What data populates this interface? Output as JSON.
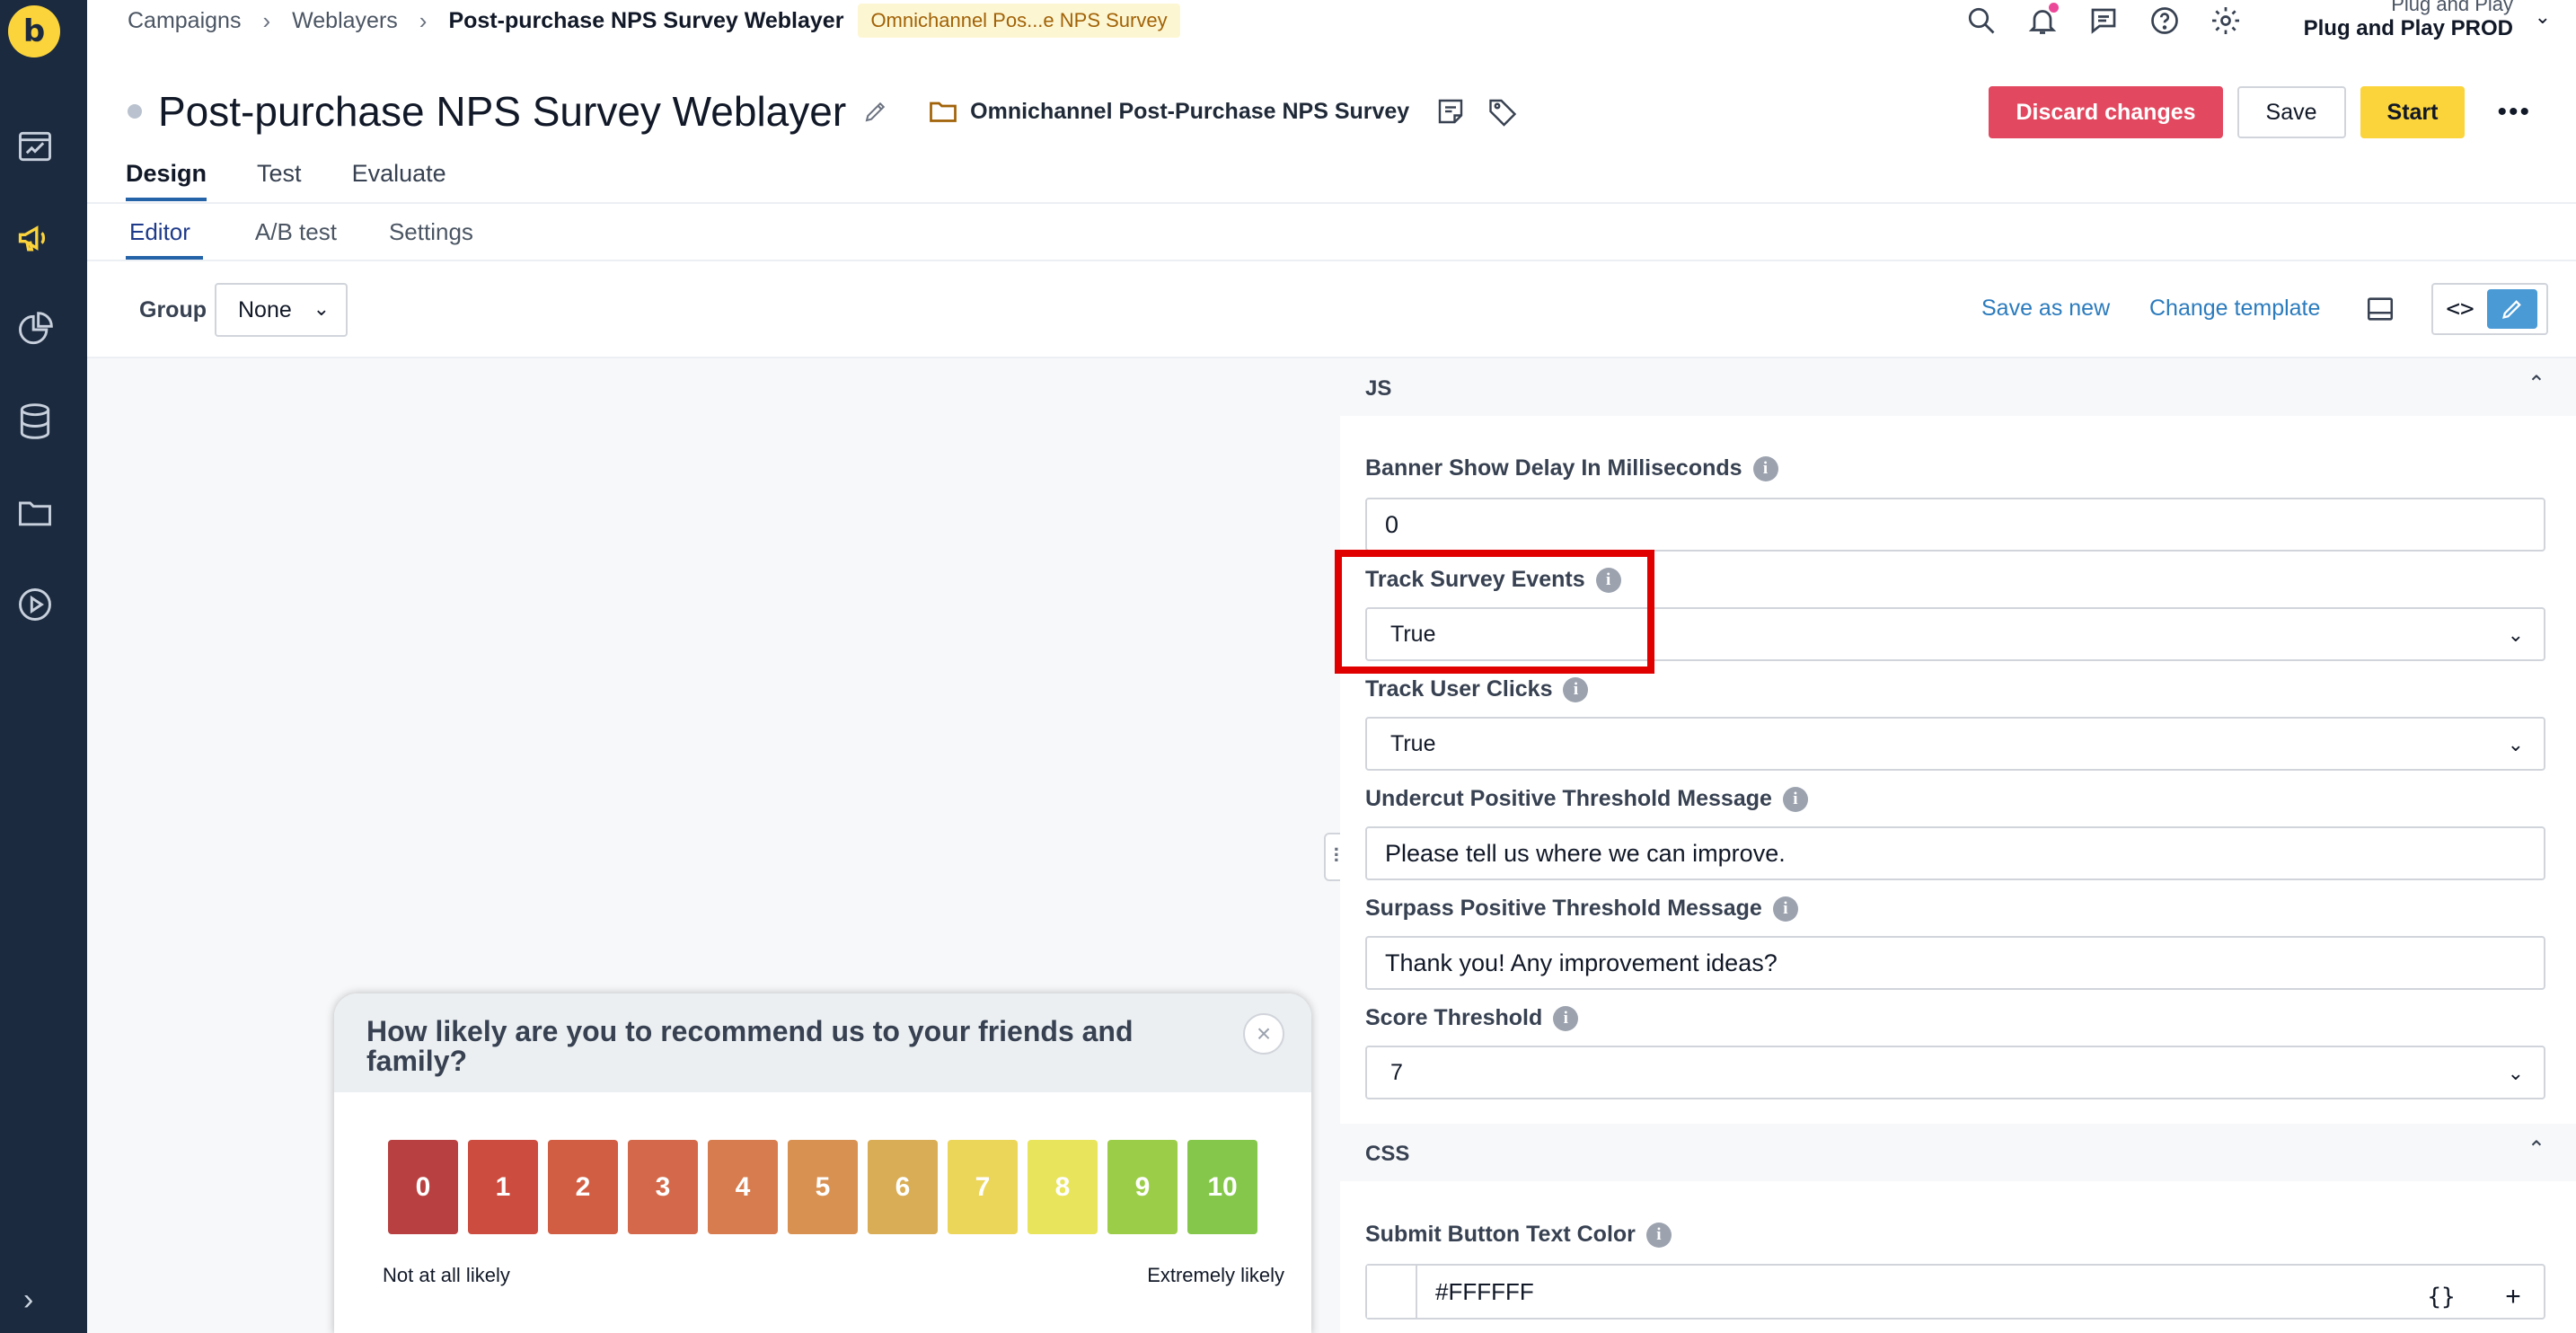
{
  "breadcrumb": {
    "items": [
      "Campaigns",
      "Weblayers",
      "Post-purchase NPS Survey Weblayer"
    ],
    "tag": "Omnichannel Pos...e NPS Survey"
  },
  "account": {
    "org": "Plug and Play",
    "project": "Plug and Play PROD"
  },
  "header": {
    "title": "Post-purchase NPS Survey Weblayer",
    "folder": "Omnichannel Post-Purchase NPS Survey",
    "discard_label": "Discard changes",
    "save_label": "Save",
    "start_label": "Start",
    "more_label": "•••"
  },
  "tabs_main": [
    "Design",
    "Test",
    "Evaluate"
  ],
  "tabs_sub": [
    "Editor",
    "A/B test",
    "Settings"
  ],
  "toolbar": {
    "group_label": "Group",
    "group_value": "None",
    "save_as_new": "Save as new",
    "change_template": "Change template",
    "code_label": "<>"
  },
  "survey": {
    "question": "How likely are you to recommend us to your friends and family?",
    "close_label": "×",
    "scores": [
      "0",
      "1",
      "2",
      "3",
      "4",
      "5",
      "6",
      "7",
      "8",
      "9",
      "10"
    ],
    "score_colors": [
      "#b84040",
      "#cc4c3f",
      "#d15d42",
      "#d3694a",
      "#d77c4e",
      "#d89151",
      "#d8ad55",
      "#ecd65a",
      "#e8e45c",
      "#9ccd48",
      "#84c74a"
    ],
    "low_label": "Not at all likely",
    "high_label": "Extremely likely"
  },
  "panel": {
    "js_section": "JS",
    "css_section": "CSS",
    "fields": {
      "banner_delay": {
        "label": "Banner Show Delay In Milliseconds",
        "value": "0"
      },
      "track_survey": {
        "label": "Track Survey Events",
        "value": "True"
      },
      "track_clicks": {
        "label": "Track User Clicks",
        "value": "True"
      },
      "undercut_msg": {
        "label": "Undercut Positive Threshold Message",
        "value": "Please tell us where we can improve."
      },
      "surpass_msg": {
        "label": "Surpass Positive Threshold Message",
        "value": "Thank you! Any improvement ideas?"
      },
      "score_threshold": {
        "label": "Score Threshold",
        "value": "7"
      },
      "submit_text_color": {
        "label": "Submit Button Text Color",
        "value": "#FFFFFF"
      }
    }
  },
  "fab": {
    "braces": "{}",
    "plus": "+"
  },
  "colors": {
    "accent": "#2563a8",
    "brand_yellow": "#fbd43c",
    "danger": "#e2485f",
    "rail": "#1c2a3f",
    "highlight": "#e00000"
  }
}
